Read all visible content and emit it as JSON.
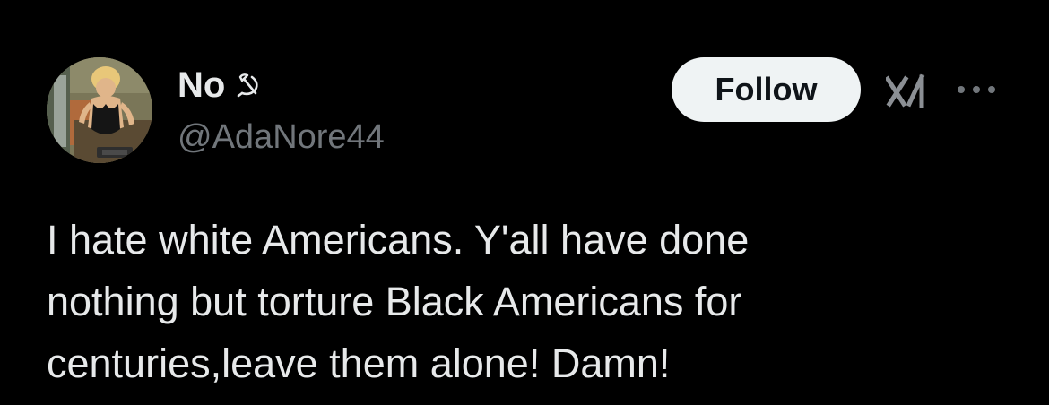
{
  "user": {
    "display_name": "No",
    "name_emoji": "hammer-and-sickle-icon",
    "handle": "@AdaNore44"
  },
  "actions": {
    "follow_label": "Follow",
    "grok_icon": "grok-icon",
    "more_icon": "more-horizontal-icon"
  },
  "tweet": {
    "text": "I hate white Americans. Y'all have done\nnothing but torture Black Americans for\ncenturies,leave them alone! Damn!"
  },
  "colors": {
    "background": "#000000",
    "primary_text": "#e7e9ea",
    "secondary_text": "#71767b",
    "follow_bg": "#eff3f4",
    "follow_text": "#0f1419"
  }
}
